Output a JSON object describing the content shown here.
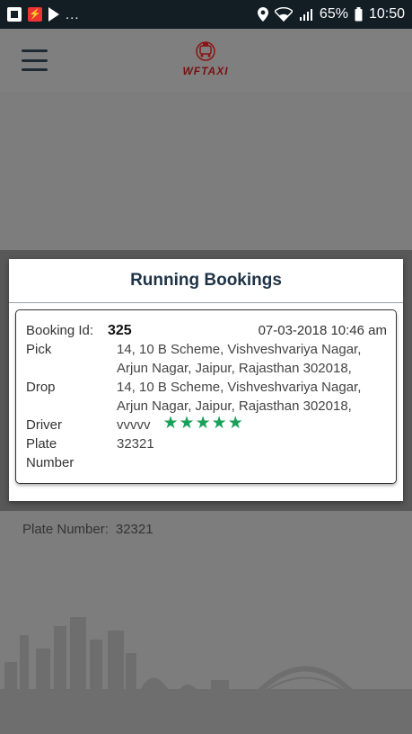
{
  "status_bar": {
    "left_icons": [
      "flipboard-icon",
      "flash-icon",
      "play-store-icon"
    ],
    "ellipsis": "...",
    "battery": "65%",
    "time": "10:50"
  },
  "app_bar": {
    "logo_text": "WFTAXI"
  },
  "background": {
    "plate_label": "Plate Number:",
    "plate_value": "32321"
  },
  "dialog": {
    "title": "Running Bookings",
    "booking": {
      "booking_id_label": "Booking Id:",
      "booking_id": "325",
      "datetime": "07-03-2018 10:46 am",
      "pick_label": "Pick",
      "pick_value": "14, 10 B Scheme, Vishveshvariya Nagar, Arjun Nagar, Jaipur, Rajasthan 302018,",
      "drop_label": "Drop",
      "drop_value": "14, 10 B Scheme, Vishveshvariya Nagar, Arjun Nagar, Jaipur, Rajasthan 302018,",
      "driver_label": "Driver",
      "driver_value": "vvvvv",
      "rating": 5,
      "plate_label_1": "Plate",
      "plate_label_2": "Number",
      "plate_value": "32321"
    }
  },
  "colors": {
    "status_bar": "#121d24",
    "title_text": "#1f3346",
    "star": "#1aa05a"
  }
}
